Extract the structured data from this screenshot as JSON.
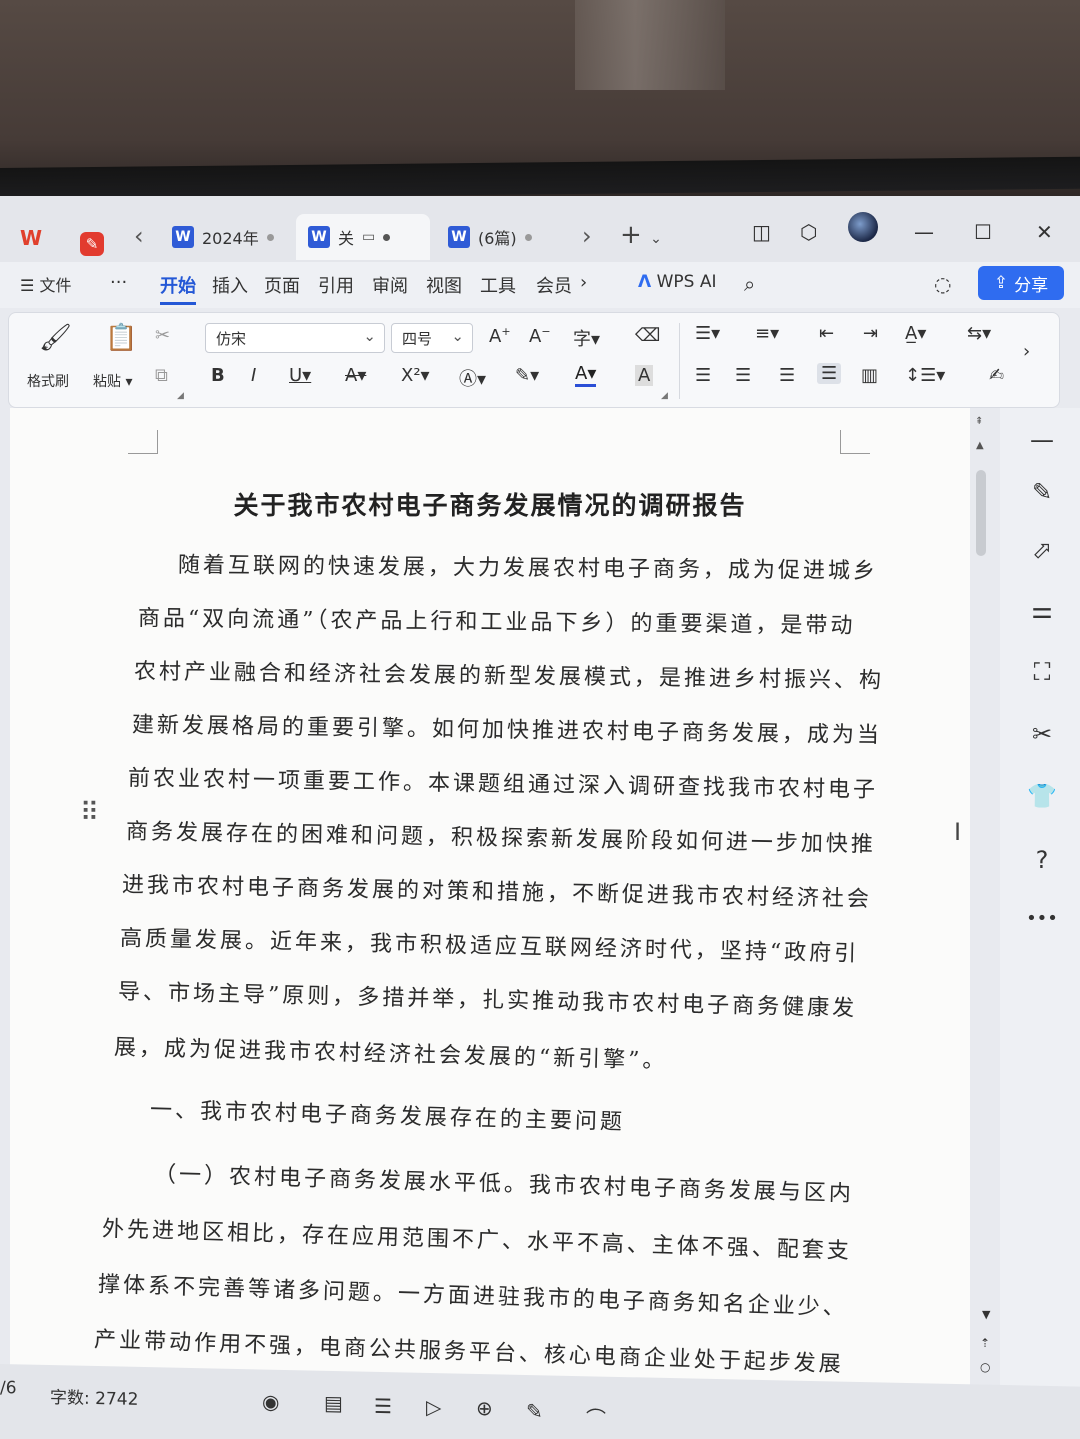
{
  "titlebar": {
    "tabs": [
      {
        "label": "2024年"
      },
      {
        "label": "关"
      },
      {
        "label": "(6篇)"
      }
    ],
    "icons": [
      "wps-logo-icon",
      "pdf-icon",
      "back-icon",
      "forward-icon",
      "plus-icon",
      "layout-icon",
      "box-icon",
      "avatar",
      "minimize-icon",
      "maximize-icon",
      "close-icon"
    ]
  },
  "menubar": {
    "items": [
      {
        "label": "文件"
      },
      {
        "label": "开始"
      },
      {
        "label": "插入"
      },
      {
        "label": "页面"
      },
      {
        "label": "引用"
      },
      {
        "label": "审阅"
      },
      {
        "label": "视图"
      },
      {
        "label": "工具"
      },
      {
        "label": "会员"
      }
    ],
    "more": "···",
    "wps_ai": "WPS AI",
    "share": "分享"
  },
  "ribbon": {
    "format_painter": "格式刷",
    "paste": "粘贴",
    "font_name": "仿宋",
    "font_size": "四号"
  },
  "document": {
    "title": "关于我市农村电子商务发展情况的调研报告",
    "lines": [
      "随着互联网的快速发展，大力发展农村电子商务，成为促进城乡",
      "商品“双向流通”（农产品上行和工业品下乡）的重要渠道，是带动",
      "农村产业融合和经济社会发展的新型发展模式，是推进乡村振兴、构",
      "建新发展格局的重要引擎。如何加快推进农村电子商务发展，成为当",
      "前农业农村一项重要工作。本课题组通过深入调研查找我市农村电子",
      "商务发展存在的困难和问题，积极探索新发展阶段如何进一步加快推",
      "进我市农村电子商务发展的对策和措施，不断促进我市农村经济社会",
      "高质量发展。近年来，我市积极适应互联网经济时代，坚持“政府引",
      "导、市场主导”原则，多措并举，扎实推动我市农村电子商务健康发",
      "展，成为促进我市农村经济社会发展的“新引擎”。",
      "一、我市农村电子商务发展存在的主要问题",
      "（一）农村电子商务发展水平低。我市农村电子商务发展与区内",
      "外先进地区相比，存在应用范围不广、水平不高、主体不强、配套支",
      "撑体系不完善等诸多问题。一方面进驻我市的电子商务知名企业少、",
      "产业带动作用不强，电商公共服务平台、核心电商企业处于起步发展"
    ]
  },
  "statusbar": {
    "page": "/6",
    "word_count": "字数: 2742"
  },
  "colors": {
    "accent": "#2458d6",
    "share_button": "#2f6cf0",
    "wps_red": "#e0402c"
  }
}
